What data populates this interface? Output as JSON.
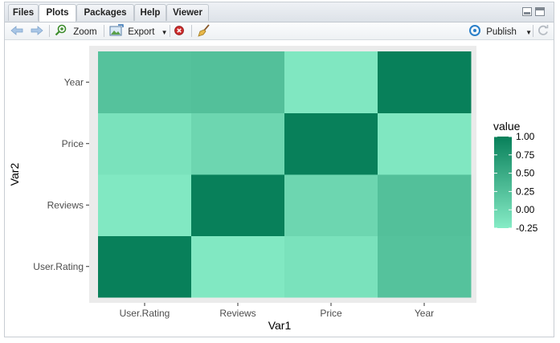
{
  "tabs": [
    {
      "label": "Files",
      "active": false
    },
    {
      "label": "Plots",
      "active": true
    },
    {
      "label": "Packages",
      "active": false
    },
    {
      "label": "Help",
      "active": false
    },
    {
      "label": "Viewer",
      "active": false
    }
  ],
  "toolbar": {
    "zoom_label": "Zoom",
    "export_label": "Export",
    "publish_label": "Publish"
  },
  "icons": {
    "back": "arrow-left-icon",
    "forward": "arrow-right-icon",
    "zoom": "magnifier-icon",
    "export": "image-export-icon",
    "remove": "close-circle-icon",
    "clear": "broom-icon",
    "publish": "publish-icon",
    "refresh": "refresh-icon"
  },
  "chart_data": {
    "type": "heatmap",
    "xlabel": "Var1",
    "ylabel": "Var2",
    "x_categories": [
      "User.Rating",
      "Reviews",
      "Price",
      "Year"
    ],
    "y_categories": [
      "User.Rating",
      "Reviews",
      "Price",
      "Year"
    ],
    "values": [
      [
        1.0,
        -0.2,
        -0.13,
        0.24
      ],
      [
        -0.2,
        1.0,
        0.0,
        0.26
      ],
      [
        -0.13,
        0.0,
        1.0,
        -0.19
      ],
      [
        0.24,
        0.26,
        -0.19,
        1.0
      ]
    ],
    "legend": {
      "title": "value",
      "ticks": [
        1.0,
        0.75,
        0.5,
        0.25,
        0.0,
        -0.25
      ],
      "tick_labels": [
        "1.00",
        "0.75",
        "0.50",
        "0.25",
        "0.00",
        "-0.25"
      ],
      "range": [
        -0.25,
        1.0
      ],
      "low_color": "#86ecc6",
      "high_color": "#08805a",
      "placement": "right"
    },
    "panel_background": "#ebebeb",
    "grid": true
  }
}
